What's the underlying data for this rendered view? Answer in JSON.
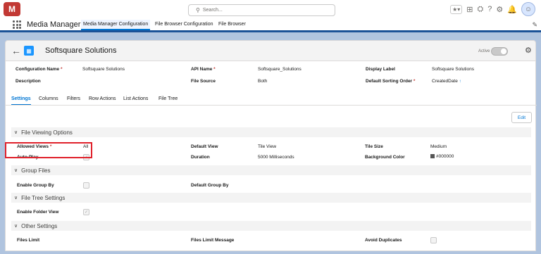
{
  "topbar": {
    "logo": "M",
    "search_placeholder": "Search..."
  },
  "nav": {
    "app_name": "Media Manager",
    "tabs": [
      "Media Manager Configuration",
      "File Browser Configuration",
      "File Browser"
    ]
  },
  "header": {
    "title": "Softsquare Solutions",
    "active_label": "Active"
  },
  "fields": {
    "config_name_label": "Configuration Name",
    "config_name_value": "Softsquare Solutions",
    "api_name_label": "API Name",
    "api_name_value": "Softsquare_Solutions",
    "display_label_label": "Display Label",
    "display_label_value": "Softsquare Solutions",
    "description_label": "Description",
    "file_source_label": "File Source",
    "file_source_value": "Both",
    "sort_label": "Default Sorting Order",
    "sort_value": "CreatedDate"
  },
  "content_tabs": [
    "Settings",
    "Columns",
    "Filters",
    "Row Actions",
    "List Actions",
    "File Tree"
  ],
  "edit_label": "Edit",
  "sections": {
    "viewing": "File Viewing Options",
    "group": "Group Files",
    "tree": "File Tree Settings",
    "other": "Other Settings"
  },
  "viewing": {
    "allowed_views_label": "Allowed Views",
    "allowed_views_value": "All",
    "default_view_label": "Default View",
    "default_view_value": "Tile View",
    "tile_size_label": "Tile Size",
    "tile_size_value": "Medium",
    "autoplay_label": "Auto-Play",
    "duration_label": "Duration",
    "duration_value": "5000 Milliseconds",
    "bg_color_label": "Background Color",
    "bg_color_value": "#000000"
  },
  "group": {
    "enable_label": "Enable Group By",
    "default_label": "Default Group By"
  },
  "tree": {
    "enable_folder_label": "Enable Folder View"
  },
  "other": {
    "files_limit_label": "Files Limit",
    "files_limit_message_label": "Files Limit Message",
    "avoid_duplicates_label": "Avoid Duplicates"
  },
  "colors": {
    "accent": "#0176d3",
    "nav_bar": "#1b5297",
    "logo": "#c23934",
    "highlight": "#e0202a"
  }
}
